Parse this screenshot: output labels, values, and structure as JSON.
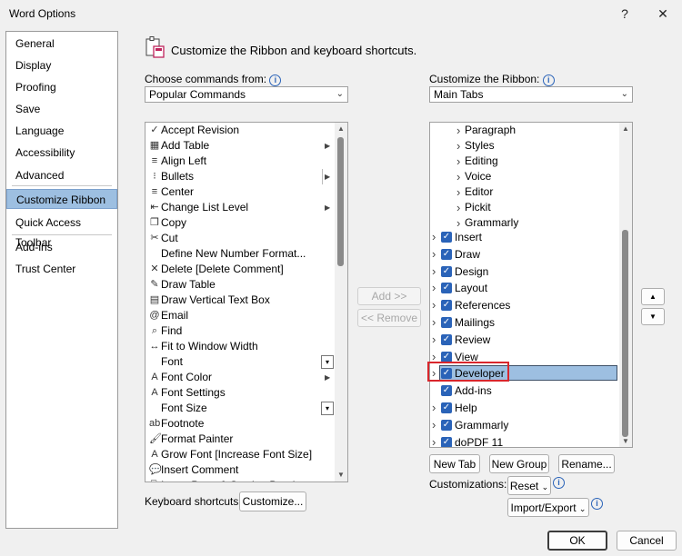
{
  "window": {
    "title": "Word Options",
    "help_glyph": "?",
    "close_glyph": "✕"
  },
  "nav": {
    "items": [
      "General",
      "Display",
      "Proofing",
      "Save",
      "Language",
      "Accessibility",
      "Advanced",
      "Customize Ribbon",
      "Quick Access Toolbar",
      "Add-ins",
      "Trust Center"
    ],
    "selected": "Customize Ribbon"
  },
  "header": {
    "text": "Customize the Ribbon and keyboard shortcuts."
  },
  "left": {
    "choose_label": "Choose commands from:",
    "choose_value": "Popular Commands",
    "commands": [
      {
        "label": "Accept Revision",
        "icon": "accept-revision-icon",
        "glyph": "✓"
      },
      {
        "label": "Add Table",
        "icon": "table-icon",
        "glyph": "▦",
        "submenu": true
      },
      {
        "label": "Align Left",
        "icon": "align-left-icon",
        "glyph": "≡"
      },
      {
        "label": "Bullets",
        "icon": "bullets-icon",
        "glyph": "⁝",
        "split": true
      },
      {
        "label": "Center",
        "icon": "center-icon",
        "glyph": "≡"
      },
      {
        "label": "Change List Level",
        "icon": "list-level-icon",
        "glyph": "⇤",
        "submenu": true
      },
      {
        "label": "Copy",
        "icon": "copy-icon",
        "glyph": "❐"
      },
      {
        "label": "Cut",
        "icon": "scissors-icon",
        "glyph": "✂"
      },
      {
        "label": "Define New Number Format...",
        "icon": "",
        "glyph": ""
      },
      {
        "label": "Delete [Delete Comment]",
        "icon": "delete-comment-icon",
        "glyph": "✕"
      },
      {
        "label": "Draw Table",
        "icon": "draw-table-icon",
        "glyph": "✎"
      },
      {
        "label": "Draw Vertical Text Box",
        "icon": "vertical-text-box-icon",
        "glyph": "▤"
      },
      {
        "label": "Email",
        "icon": "email-icon",
        "glyph": "@"
      },
      {
        "label": "Find",
        "icon": "find-icon",
        "glyph": "⌕"
      },
      {
        "label": "Fit to Window Width",
        "icon": "fit-width-icon",
        "glyph": "↔"
      },
      {
        "label": "Font",
        "icon": "",
        "glyph": "",
        "dropdown": true
      },
      {
        "label": "Font Color",
        "icon": "font-color-icon",
        "glyph": "A",
        "submenu": true
      },
      {
        "label": "Font Settings",
        "icon": "font-settings-icon",
        "glyph": "A"
      },
      {
        "label": "Font Size",
        "icon": "",
        "glyph": "",
        "dropdown": true
      },
      {
        "label": "Footnote",
        "icon": "footnote-icon",
        "glyph": "ab"
      },
      {
        "label": "Format Painter",
        "icon": "format-painter-icon",
        "glyph": "🖌"
      },
      {
        "label": "Grow Font [Increase Font Size]",
        "icon": "grow-font-icon",
        "glyph": "A"
      },
      {
        "label": "Insert Comment",
        "icon": "insert-comment-icon",
        "glyph": "💬"
      },
      {
        "label": "Insert Page & Section Breaks",
        "icon": "page-break-icon",
        "glyph": "⎘"
      }
    ],
    "keyboard_label": "Keyboard shortcuts:",
    "customize_button": "Customize..."
  },
  "middle": {
    "add_button": "Add >>",
    "remove_button": "<< Remove"
  },
  "right": {
    "customize_label": "Customize the Ribbon:",
    "customize_value": "Main Tabs",
    "groups": [
      "Paragraph",
      "Styles",
      "Editing",
      "Voice",
      "Editor",
      "Pickit",
      "Grammarly"
    ],
    "tabs": [
      {
        "label": "Insert",
        "checked": true
      },
      {
        "label": "Draw",
        "checked": true
      },
      {
        "label": "Design",
        "checked": true
      },
      {
        "label": "Layout",
        "checked": true
      },
      {
        "label": "References",
        "checked": true
      },
      {
        "label": "Mailings",
        "checked": true
      },
      {
        "label": "Review",
        "checked": true
      },
      {
        "label": "View",
        "checked": true
      },
      {
        "label": "Developer",
        "checked": true,
        "selected": true
      },
      {
        "label": "Add-ins",
        "checked": true,
        "no_expander": true
      },
      {
        "label": "Help",
        "checked": true
      },
      {
        "label": "Grammarly",
        "checked": true
      },
      {
        "label": "doPDF 11",
        "checked": true
      }
    ],
    "new_tab": "New Tab",
    "new_group": "New Group",
    "rename": "Rename...",
    "customizations_label": "Customizations:",
    "reset": "Reset",
    "import_export": "Import/Export"
  },
  "footer": {
    "ok": "OK",
    "cancel": "Cancel"
  },
  "colors": {
    "accent": "#2a63b8",
    "selection": "#9dbfe1",
    "highlight_box": "#d9262c"
  }
}
